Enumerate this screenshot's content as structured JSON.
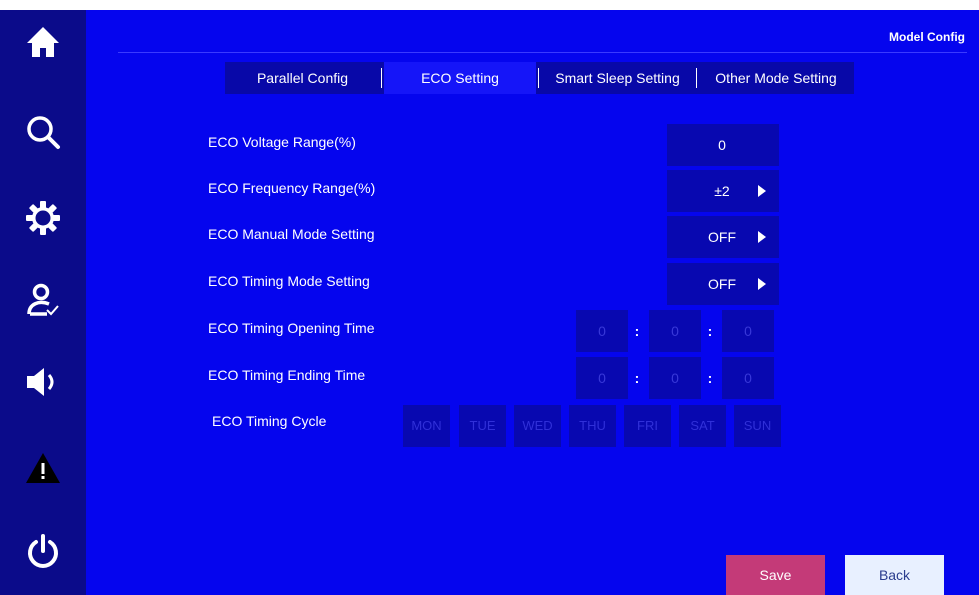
{
  "header": {
    "title": "Model Config"
  },
  "sidebar": {
    "items": [
      {
        "icon": "home-icon"
      },
      {
        "icon": "search-icon"
      },
      {
        "icon": "settings-gear-icon"
      },
      {
        "icon": "user-check-icon"
      },
      {
        "icon": "speaker-icon"
      },
      {
        "icon": "warning-icon"
      },
      {
        "icon": "power-icon"
      }
    ]
  },
  "tabs": [
    {
      "label": "Parallel Config",
      "active": false
    },
    {
      "label": "ECO Setting",
      "active": true
    },
    {
      "label": "Smart Sleep Setting",
      "active": false
    },
    {
      "label": "Other Mode Setting",
      "active": false
    }
  ],
  "settings": {
    "voltage_range": {
      "label": "ECO Voltage Range(%)",
      "value": "0"
    },
    "frequency_range": {
      "label": "ECO Frequency Range(%)",
      "value": "±2"
    },
    "manual_mode": {
      "label": "ECO Manual Mode Setting",
      "value": "OFF"
    },
    "timing_mode": {
      "label": "ECO Timing Mode Setting",
      "value": "OFF"
    },
    "opening_time": {
      "label": "ECO Timing Opening Time",
      "h": "0",
      "m": "0",
      "s": "0"
    },
    "ending_time": {
      "label": "ECO Timing Ending Time",
      "h": "0",
      "m": "0",
      "s": "0"
    },
    "cycle": {
      "label": "ECO Timing Cycle",
      "days": [
        "MON",
        "TUE",
        "WED",
        "THU",
        "FRI",
        "SAT",
        "SUN"
      ]
    }
  },
  "separator": ":",
  "buttons": {
    "save": "Save",
    "back": "Back"
  },
  "colors": {
    "sidebar": "#0b0b8a",
    "background": "#0505ee",
    "panel": "#0808b0",
    "active_tab": "#1515f8",
    "save": "#c43a78",
    "back": "#e8f0ff"
  }
}
